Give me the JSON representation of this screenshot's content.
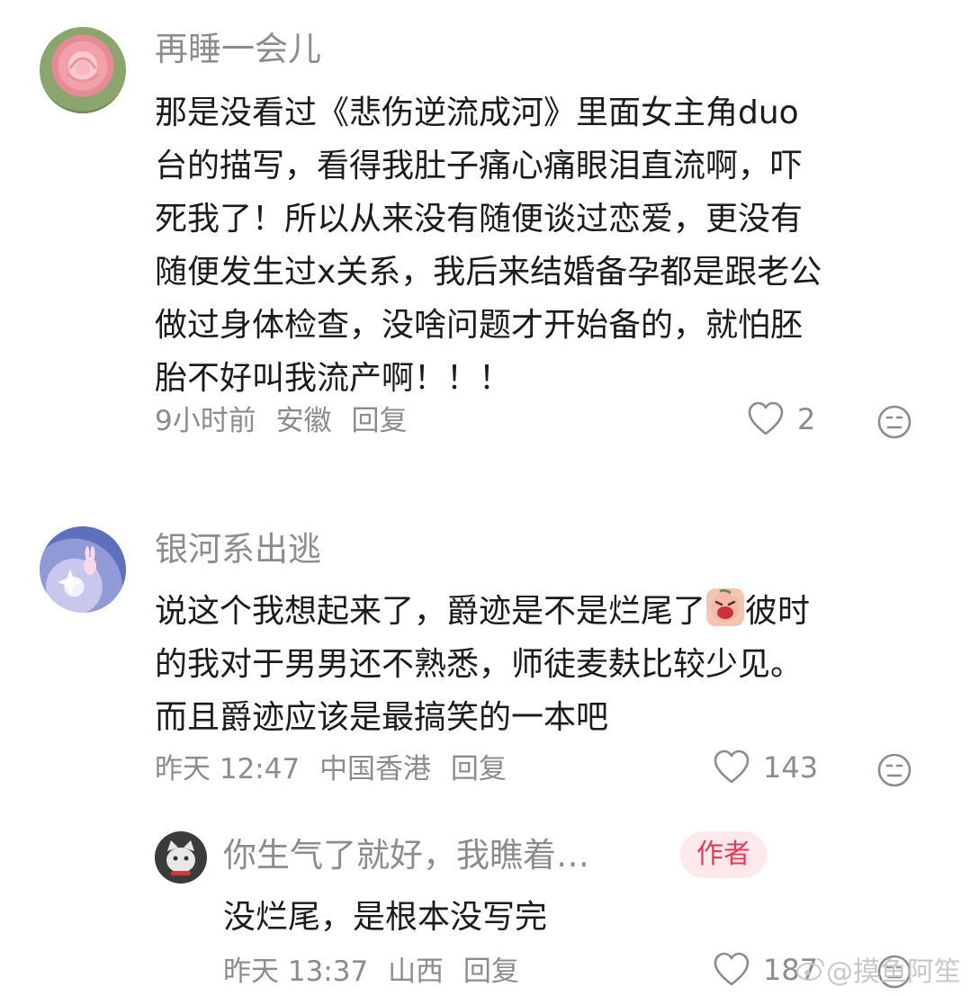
{
  "comments": [
    {
      "author": "再睡一会儿",
      "lines": [
        "那是没看过《悲伤逆流成河》里面女主角duo",
        "台的描写，看得我肚子痛心痛眼泪直流啊，吓",
        "死我了！所以从来没有随便谈过恋爱，更没有",
        "随便发生过x关系，我后来结婚备孕都是跟老公",
        "做过身体检查，没啥问题才开始备的，就怕胚",
        "胎不好叫我流产啊！！！"
      ],
      "time": "9小时前",
      "location": "安徽",
      "reply_label": "回复",
      "likes": "2"
    },
    {
      "author": "银河系出逃",
      "line1_before": "说这个我想起来了，爵迹是不是烂尾了",
      "line1_after": "彼时",
      "line2": "的我对于男男还不熟悉，师徒麦麸比较少见。",
      "line3": "而且爵迹应该是最搞笑的一本吧",
      "emoji": "crying-face-sticker",
      "time": "昨天 12:47",
      "location": "中国香港",
      "reply_label": "回复",
      "likes": "143"
    },
    {
      "author": "你生气了就好，我瞧着…",
      "badge": "作者",
      "line": "没烂尾，是根本没写完",
      "time": "昨天 13:37",
      "location": "山西",
      "reply_label": "回复",
      "likes": "187"
    }
  ],
  "watermark": "@摸鱼阿笙",
  "colors": {
    "meta": "#8c8c8c",
    "text": "#1b1b1b",
    "badge_bg": "#fde9ec",
    "badge_text": "#e43a5a"
  }
}
